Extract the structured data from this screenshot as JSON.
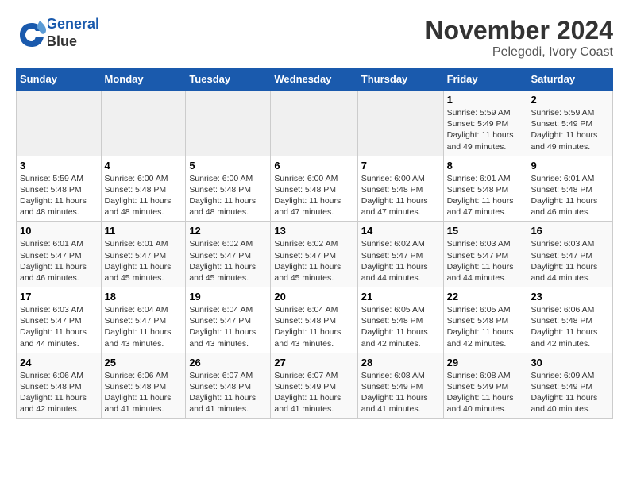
{
  "header": {
    "logo_line1": "General",
    "logo_line2": "Blue",
    "month_year": "November 2024",
    "location": "Pelegodi, Ivory Coast"
  },
  "days_of_week": [
    "Sunday",
    "Monday",
    "Tuesday",
    "Wednesday",
    "Thursday",
    "Friday",
    "Saturday"
  ],
  "weeks": [
    [
      {
        "day": "",
        "info": ""
      },
      {
        "day": "",
        "info": ""
      },
      {
        "day": "",
        "info": ""
      },
      {
        "day": "",
        "info": ""
      },
      {
        "day": "",
        "info": ""
      },
      {
        "day": "1",
        "info": "Sunrise: 5:59 AM\nSunset: 5:49 PM\nDaylight: 11 hours and 49 minutes."
      },
      {
        "day": "2",
        "info": "Sunrise: 5:59 AM\nSunset: 5:49 PM\nDaylight: 11 hours and 49 minutes."
      }
    ],
    [
      {
        "day": "3",
        "info": "Sunrise: 5:59 AM\nSunset: 5:48 PM\nDaylight: 11 hours and 48 minutes."
      },
      {
        "day": "4",
        "info": "Sunrise: 6:00 AM\nSunset: 5:48 PM\nDaylight: 11 hours and 48 minutes."
      },
      {
        "day": "5",
        "info": "Sunrise: 6:00 AM\nSunset: 5:48 PM\nDaylight: 11 hours and 48 minutes."
      },
      {
        "day": "6",
        "info": "Sunrise: 6:00 AM\nSunset: 5:48 PM\nDaylight: 11 hours and 47 minutes."
      },
      {
        "day": "7",
        "info": "Sunrise: 6:00 AM\nSunset: 5:48 PM\nDaylight: 11 hours and 47 minutes."
      },
      {
        "day": "8",
        "info": "Sunrise: 6:01 AM\nSunset: 5:48 PM\nDaylight: 11 hours and 47 minutes."
      },
      {
        "day": "9",
        "info": "Sunrise: 6:01 AM\nSunset: 5:48 PM\nDaylight: 11 hours and 46 minutes."
      }
    ],
    [
      {
        "day": "10",
        "info": "Sunrise: 6:01 AM\nSunset: 5:47 PM\nDaylight: 11 hours and 46 minutes."
      },
      {
        "day": "11",
        "info": "Sunrise: 6:01 AM\nSunset: 5:47 PM\nDaylight: 11 hours and 45 minutes."
      },
      {
        "day": "12",
        "info": "Sunrise: 6:02 AM\nSunset: 5:47 PM\nDaylight: 11 hours and 45 minutes."
      },
      {
        "day": "13",
        "info": "Sunrise: 6:02 AM\nSunset: 5:47 PM\nDaylight: 11 hours and 45 minutes."
      },
      {
        "day": "14",
        "info": "Sunrise: 6:02 AM\nSunset: 5:47 PM\nDaylight: 11 hours and 44 minutes."
      },
      {
        "day": "15",
        "info": "Sunrise: 6:03 AM\nSunset: 5:47 PM\nDaylight: 11 hours and 44 minutes."
      },
      {
        "day": "16",
        "info": "Sunrise: 6:03 AM\nSunset: 5:47 PM\nDaylight: 11 hours and 44 minutes."
      }
    ],
    [
      {
        "day": "17",
        "info": "Sunrise: 6:03 AM\nSunset: 5:47 PM\nDaylight: 11 hours and 44 minutes."
      },
      {
        "day": "18",
        "info": "Sunrise: 6:04 AM\nSunset: 5:47 PM\nDaylight: 11 hours and 43 minutes."
      },
      {
        "day": "19",
        "info": "Sunrise: 6:04 AM\nSunset: 5:47 PM\nDaylight: 11 hours and 43 minutes."
      },
      {
        "day": "20",
        "info": "Sunrise: 6:04 AM\nSunset: 5:48 PM\nDaylight: 11 hours and 43 minutes."
      },
      {
        "day": "21",
        "info": "Sunrise: 6:05 AM\nSunset: 5:48 PM\nDaylight: 11 hours and 42 minutes."
      },
      {
        "day": "22",
        "info": "Sunrise: 6:05 AM\nSunset: 5:48 PM\nDaylight: 11 hours and 42 minutes."
      },
      {
        "day": "23",
        "info": "Sunrise: 6:06 AM\nSunset: 5:48 PM\nDaylight: 11 hours and 42 minutes."
      }
    ],
    [
      {
        "day": "24",
        "info": "Sunrise: 6:06 AM\nSunset: 5:48 PM\nDaylight: 11 hours and 42 minutes."
      },
      {
        "day": "25",
        "info": "Sunrise: 6:06 AM\nSunset: 5:48 PM\nDaylight: 11 hours and 41 minutes."
      },
      {
        "day": "26",
        "info": "Sunrise: 6:07 AM\nSunset: 5:48 PM\nDaylight: 11 hours and 41 minutes."
      },
      {
        "day": "27",
        "info": "Sunrise: 6:07 AM\nSunset: 5:49 PM\nDaylight: 11 hours and 41 minutes."
      },
      {
        "day": "28",
        "info": "Sunrise: 6:08 AM\nSunset: 5:49 PM\nDaylight: 11 hours and 41 minutes."
      },
      {
        "day": "29",
        "info": "Sunrise: 6:08 AM\nSunset: 5:49 PM\nDaylight: 11 hours and 40 minutes."
      },
      {
        "day": "30",
        "info": "Sunrise: 6:09 AM\nSunset: 5:49 PM\nDaylight: 11 hours and 40 minutes."
      }
    ]
  ]
}
